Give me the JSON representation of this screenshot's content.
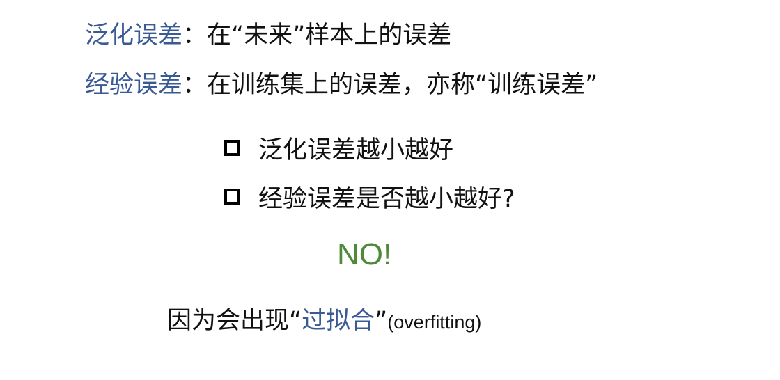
{
  "generalization": {
    "term": "泛化误差",
    "colon": "：",
    "definition": "在“未来”样本上的误差"
  },
  "empirical": {
    "term": "经验误差",
    "colon": "：",
    "definition": "在训练集上的误差，亦称“训练误差”"
  },
  "bullets": [
    "泛化误差越小越好",
    "经验误差是否越小越好?"
  ],
  "answer": "NO!",
  "reason": {
    "prefix": "因为会出现“",
    "highlight": "过拟合",
    "suffix": "”",
    "english": "(overfitting)"
  },
  "colors": {
    "term_blue": "#3a5a95",
    "answer_green": "#4f8a3a",
    "text": "#111111"
  },
  "icons": {
    "bullet": "checkbox-square-icon"
  }
}
